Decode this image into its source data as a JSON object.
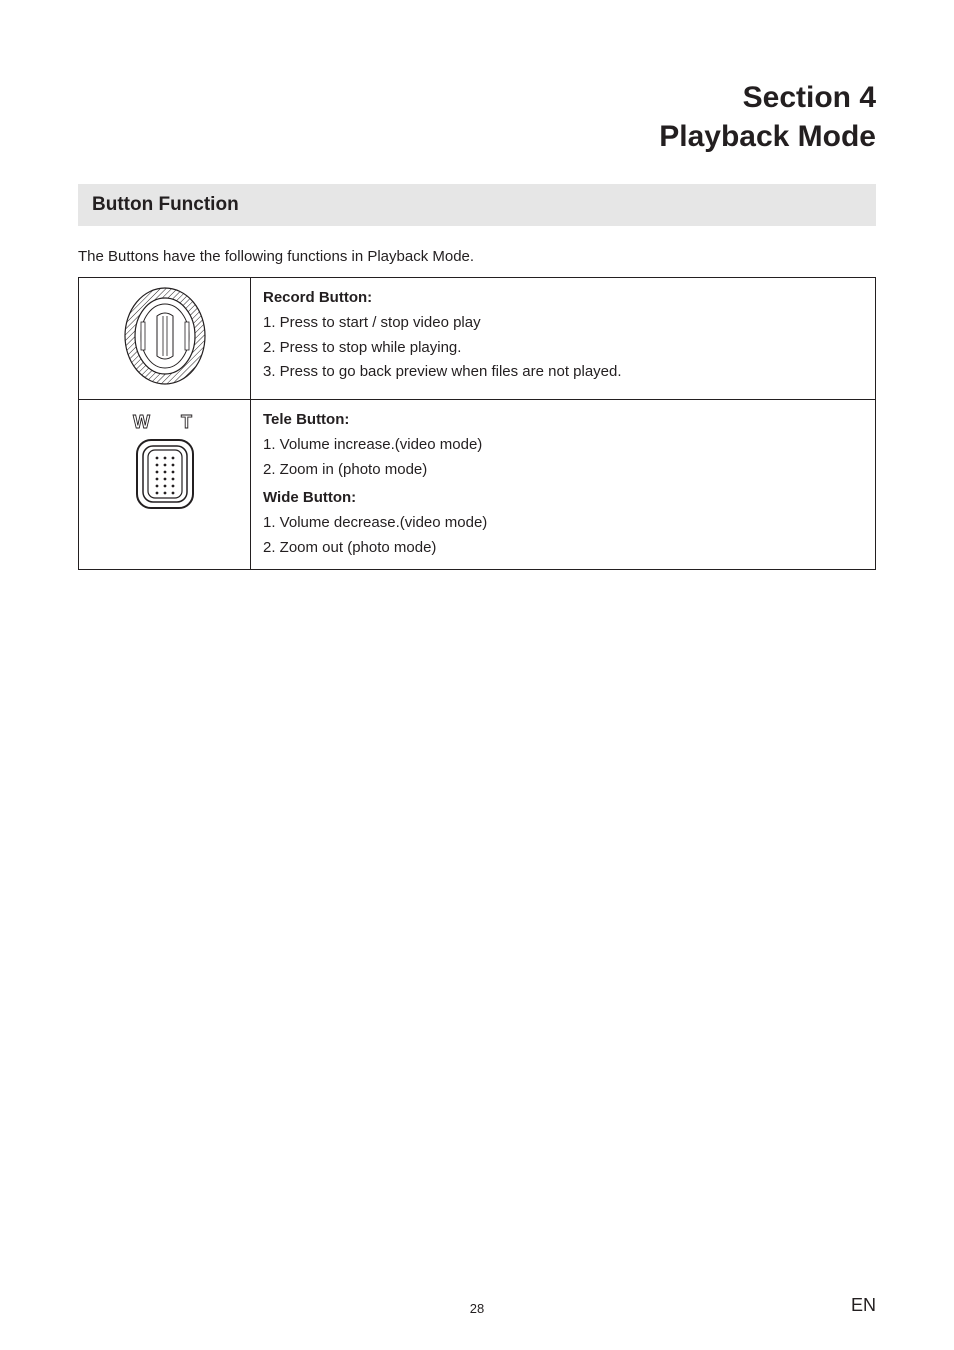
{
  "header": {
    "section_line": "Section 4",
    "title_line": "Playback Mode"
  },
  "subsection": {
    "heading": "Button Function"
  },
  "intro_text": "The Buttons have the following functions in Playback Mode.",
  "rows": [
    {
      "heading": "Record Button:",
      "items": [
        "1.  Press to start / stop video play",
        "2.  Press to stop while playing.",
        "3.  Press to go back preview when files are not played."
      ]
    },
    {
      "heading1": "Tele Button:",
      "items1": [
        "1.  Volume increase.(video mode)",
        "2.  Zoom in (photo mode)"
      ],
      "heading2": "Wide Button:",
      "items2": [
        "1.  Volume decrease.(video mode)",
        "2.  Zoom out (photo mode)"
      ]
    }
  ],
  "footer": {
    "page_number": "28",
    "lang": "EN"
  }
}
